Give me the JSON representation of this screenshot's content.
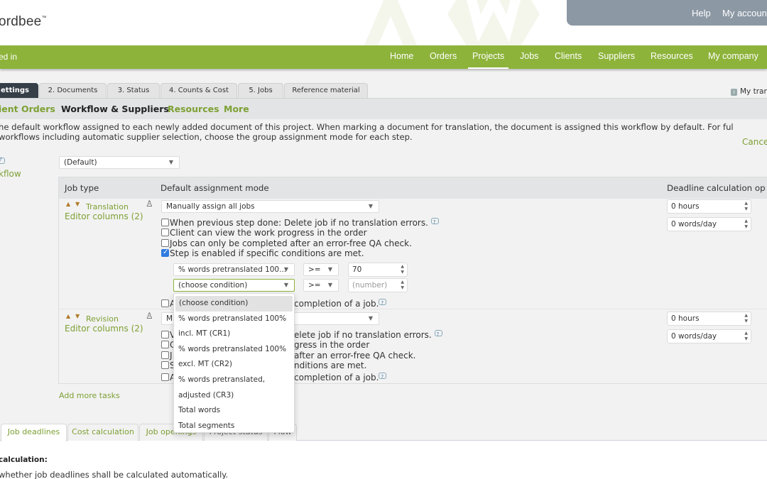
{
  "header": {
    "logo": "ordbee",
    "logo_tm": "™",
    "account_links": [
      "Help",
      "My accoun"
    ]
  },
  "navbar": {
    "logged_in": "ed in",
    "items": [
      "Home",
      "Orders",
      "Projects",
      "Jobs",
      "Clients",
      "Suppliers",
      "Resources",
      "My company"
    ],
    "active": "Projects"
  },
  "project_tabs": {
    "items": [
      "ettings",
      "2. Documents",
      "3. Status",
      "4. Counts & Cost",
      "5. Jobs",
      "Reference material"
    ],
    "active": "ettings",
    "my_translations": "My trar"
  },
  "subnav": {
    "items": [
      "ient Orders",
      "Workflow & Suppliers",
      "Resources",
      "More"
    ],
    "active": "Workflow & Suppliers"
  },
  "description": {
    "line1": "he default workflow assigned to each newly added document of this project. When marking a document for translation, the document is assigned this workflow by default. For ful",
    "line2": " workflows including automatic supplier selection, choose the group assignment mode for each step.",
    "cancel": "Cance"
  },
  "workflow": {
    "label": "kflow",
    "selected": "(Default)"
  },
  "table": {
    "headers": {
      "job_type": "Job type",
      "assignment": "Default assignment mode",
      "deadline": "Deadline calculation op"
    },
    "rows": [
      {
        "job": "Translation",
        "editor_columns": "Editor columns (2)",
        "assignment_mode": "Manually assign all jobs",
        "checkboxes": [
          {
            "label": "When previous step done: Delete job if no translation errors.",
            "checked": false,
            "help": true
          },
          {
            "label": "Client can view the work progress in the order",
            "checked": false
          },
          {
            "label": "Jobs can only be completed after an error-free QA check.",
            "checked": false
          },
          {
            "label": "Step is enabled if specific conditions are met.",
            "checked": true
          }
        ],
        "conditions": [
          {
            "field": "% words pretranslated 100...",
            "operator": ">=",
            "value": "70"
          },
          {
            "field": "(choose condition)",
            "operator": ">=",
            "value": "",
            "placeholder": "(number)"
          }
        ],
        "last_checkbox": {
          "label_prefix": "A",
          "label_suffix": "completion of a job.",
          "checked": false
        },
        "hours": "0 hours",
        "words_per_day": "0 words/day"
      },
      {
        "job": "Revision",
        "editor_columns": "Editor columns (2)",
        "assignment_mode": "M",
        "checkboxes": [
          {
            "prefix": "V",
            "suffix": "elete job if no translation errors.",
            "checked": false,
            "help": true
          },
          {
            "prefix": "C",
            "suffix": "gress in the order",
            "checked": false
          },
          {
            "prefix": "J",
            "suffix": "after an error-free QA check.",
            "checked": false
          },
          {
            "prefix": "S",
            "suffix": "nditions are met.",
            "checked": false
          },
          {
            "prefix": "A",
            "suffix": "completion of a job.",
            "checked": false,
            "help": true
          }
        ],
        "hours": "0 hours",
        "words_per_day": "0 words/day"
      }
    ],
    "add_more_tasks": "Add more tasks"
  },
  "condition_dropdown": {
    "options": [
      "(choose condition)",
      "% words pretranslated 100%",
      "incl. MT (CR1)",
      "% words pretranslated 100%",
      "excl. MT (CR2)",
      "% words pretranslated,",
      "adjusted (CR3)",
      "Total words",
      "Total segments"
    ],
    "highlighted": "(choose condition)"
  },
  "bottom_tabs": {
    "items": [
      "Job deadlines",
      "Cost calculation",
      "Job openings",
      "Project status",
      "Flow"
    ],
    "active": "Job deadlines"
  },
  "deadline_section": {
    "title": "calculation:",
    "description": "whether job deadlines shall be calculated automatically."
  }
}
